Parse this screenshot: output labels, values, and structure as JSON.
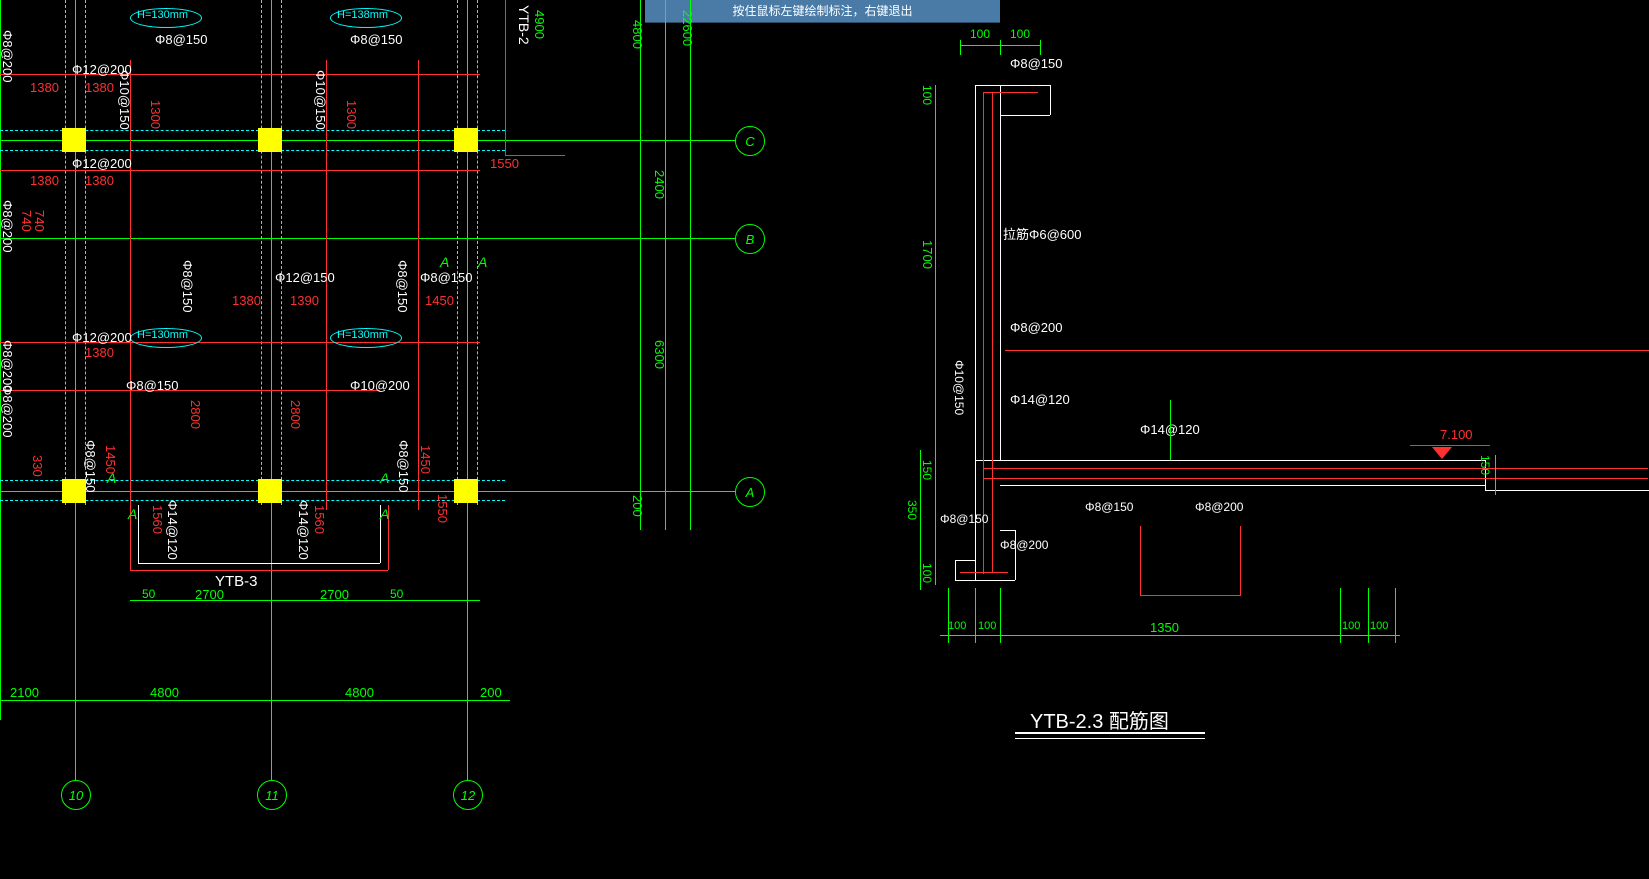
{
  "banner": "按住鼠标左键绘制标注，右键退出",
  "labels": {
    "H130": "H=130mm",
    "H138": "H=138mm",
    "phi8_150": "Φ8@150",
    "phi8_200": "Φ8@200",
    "phi10_150": "Φ10@150",
    "phi10_200": "Φ10@200",
    "phi12_150": "Φ12@150",
    "phi12_200": "Φ12@200",
    "phi14_120": "Φ14@120",
    "phi6_600": "Φ6@600",
    "d330": "330",
    "d740": "740",
    "d1380": "1380",
    "d1390": "1390",
    "d1300": "1300",
    "d1450": "1450",
    "d1550": "1550",
    "d1560": "1560",
    "d2100": "2100",
    "d2700": "2700",
    "d2800": "2800",
    "d4800": "4800",
    "d4900": "4900",
    "d50": "50",
    "d100": "100",
    "d150": "150",
    "d200": "200",
    "d350": "350",
    "d1350": "1350",
    "d1700": "1700",
    "d2400": "2400",
    "d6300": "6300",
    "d22600": "22600",
    "d7100": "7.100",
    "ytb2": "YTB-2",
    "ytb3": "YTB-3",
    "ytb23": "YTB-2.3 配筋图",
    "A": "A",
    "B": "B",
    "C": "C",
    "g10": "10",
    "g11": "11",
    "g12": "12",
    "rebar_note": "拉筋Φ6@600"
  }
}
